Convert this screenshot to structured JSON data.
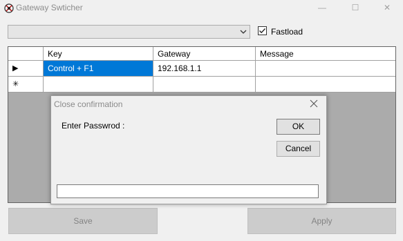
{
  "window": {
    "title": "Gateway Swticher",
    "icon": "app-logo-icon",
    "minimize": "—",
    "maximize": "☐",
    "close": "✕"
  },
  "toolbar": {
    "combo_value": "",
    "fastload_label": "Fastload",
    "fastload_checked": true
  },
  "grid": {
    "columns": [
      "Key",
      "Gateway",
      "Message"
    ],
    "rows": [
      {
        "indicator": "▶",
        "key": "Control + F1",
        "gateway": "192.168.1.1",
        "message": ""
      },
      {
        "indicator": "✳",
        "key": "",
        "gateway": "",
        "message": ""
      }
    ],
    "selection_color": "#0078d7"
  },
  "buttons": {
    "save": "Save",
    "apply": "Apply"
  },
  "dialog": {
    "title": "Close confirmation",
    "prompt": "Enter Passwrod :",
    "ok": "OK",
    "cancel": "Cancel",
    "password_value": ""
  }
}
